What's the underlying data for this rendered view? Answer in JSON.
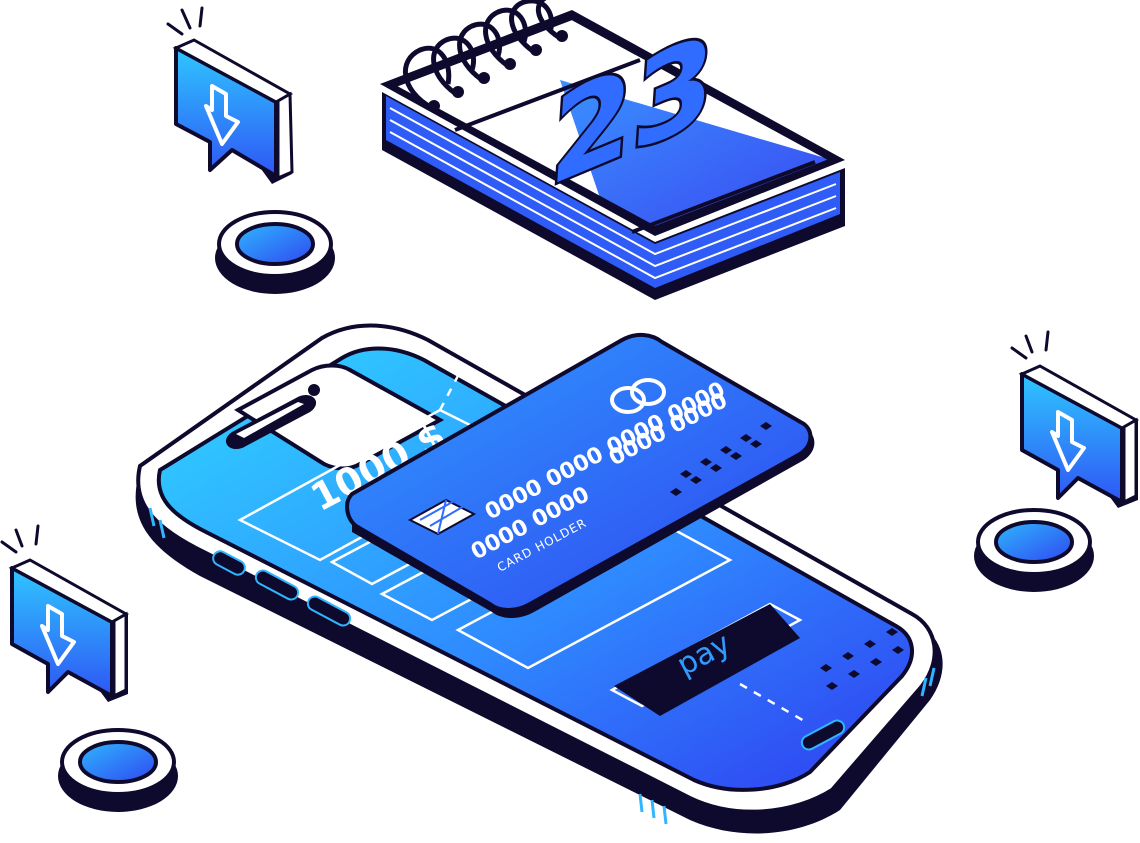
{
  "colors": {
    "outline": "#0e0a2e",
    "blue_light": "#2fd0ff",
    "blue_mid": "#2f8bff",
    "blue_dark": "#2f3ef0",
    "white": "#ffffff"
  },
  "phone": {
    "amount": "1000 $",
    "pay_button_label": "pay"
  },
  "card": {
    "number_top": "0000 0000",
    "number_mid": "0000 0000 0000 0000",
    "number_bottom": "0000 0000",
    "holder": "CARD HOLDER"
  },
  "calendar": {
    "day": "23"
  },
  "icons": [
    "download-bubble-icon",
    "coin-icon",
    "calendar-icon",
    "smartphone-icon",
    "credit-card-icon"
  ]
}
